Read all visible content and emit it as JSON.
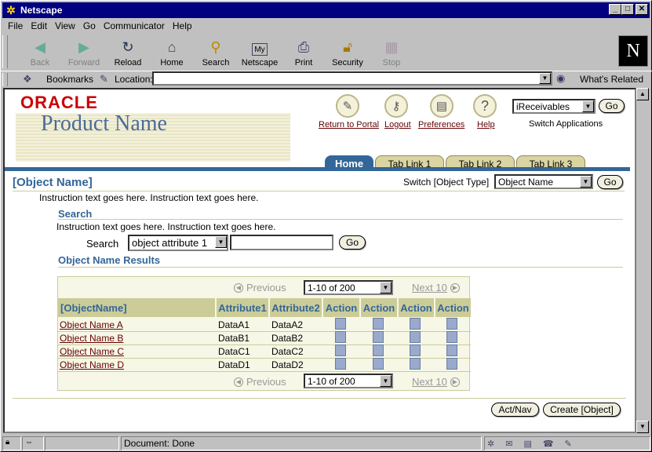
{
  "window": {
    "title": "Netscape"
  },
  "menu": [
    "File",
    "Edit",
    "View",
    "Go",
    "Communicator",
    "Help"
  ],
  "toolbar": {
    "buttons": [
      {
        "label": "Back",
        "icon": "back-icon",
        "enabled": false
      },
      {
        "label": "Forward",
        "icon": "forward-icon",
        "enabled": false
      },
      {
        "label": "Reload",
        "icon": "reload-icon",
        "enabled": true
      },
      {
        "label": "Home",
        "icon": "home-icon",
        "enabled": true
      },
      {
        "label": "Search",
        "icon": "search-icon",
        "enabled": true
      },
      {
        "label": "Netscape",
        "icon": "netscape-icon",
        "enabled": true
      },
      {
        "label": "Print",
        "icon": "print-icon",
        "enabled": true
      },
      {
        "label": "Security",
        "icon": "lock-icon",
        "enabled": true
      },
      {
        "label": "Stop",
        "icon": "stop-icon",
        "enabled": false
      }
    ]
  },
  "locationbar": {
    "bookmarks": "Bookmarks",
    "location": "Location:",
    "value": "",
    "whats_related": "What's Related"
  },
  "page": {
    "brand": "ORACLE",
    "product": "Product Name",
    "global": {
      "return": "Return to Portal",
      "logout": "Logout",
      "prefs": "Preferences",
      "help": "Help"
    },
    "app_select": "iReceivables",
    "go": "Go",
    "switch_apps": "Switch Applications",
    "tabs": [
      "Home",
      "Tab Link 1",
      "Tab Link 2",
      "Tab Link 3"
    ],
    "header": "[Object Name]",
    "switch_label": "Switch [Object Type]",
    "switch_value": "Object Name",
    "instruction": "Instruction text goes here. Instruction text goes here.",
    "search_header": "Search",
    "search_instruction": "Instruction text goes here. Instruction text goes here.",
    "search_label": "Search",
    "search_attr": "object attribute 1",
    "search_value": "",
    "results_header": "Object Name Results",
    "nav": {
      "previous": "Previous",
      "range": "1-10 of 200",
      "next": "Next 10"
    },
    "columns": [
      "[ObjectName]",
      "Attribute1",
      "Attribute2",
      "Action",
      "Action",
      "Action",
      "Action"
    ],
    "rows": [
      {
        "name": "Object Name A",
        "a1": "DataA1",
        "a2": "DataA2"
      },
      {
        "name": "Object Name B",
        "a1": "DataB1",
        "a2": "DataB2"
      },
      {
        "name": "Object Name C",
        "a1": "DataC1",
        "a2": "DataC2"
      },
      {
        "name": "Object Name D",
        "a1": "DataD1",
        "a2": "DataD2"
      }
    ],
    "actnav": "Act/Nav",
    "create": "Create [Object]"
  },
  "status": {
    "text": "Document: Done"
  }
}
